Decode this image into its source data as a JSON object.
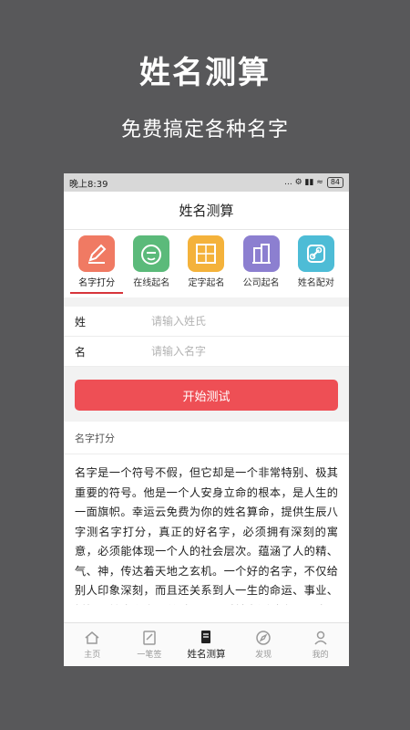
{
  "promo": {
    "title": "姓名测算",
    "subtitle": "免费搞定各种名字"
  },
  "statusbar": {
    "time": "晚上8:39",
    "icons_text": "... ⚙ ▮▮ ≈",
    "battery": "84"
  },
  "navbar": {
    "title": "姓名测算"
  },
  "categories": [
    {
      "label": "名字打分",
      "icon": "pencil-icon",
      "color": "#f07a63",
      "active": true
    },
    {
      "label": "在线起名",
      "icon": "face-name-icon",
      "color": "#5bba7a",
      "active": false
    },
    {
      "label": "定字起名",
      "icon": "grid-name-icon",
      "color": "#f4b23b",
      "active": false
    },
    {
      "label": "公司起名",
      "icon": "building-icon",
      "color": "#8c7fd0",
      "active": false
    },
    {
      "label": "姓名配对",
      "icon": "link-icon",
      "color": "#4dbcd6",
      "active": false
    }
  ],
  "form": {
    "surname_label": "姓",
    "surname_placeholder": "请输入姓氏",
    "given_label": "名",
    "given_placeholder": "请输入名字"
  },
  "start_button": "开始测试",
  "section_title": "名字打分",
  "description": "名字是一个符号不假，但它却是一个非常特别、极其重要的符号。他是一个人安身立命的根本，是人生的一面旗帜。幸运云免费为你的姓名算命，提供生辰八字测名字打分，真正的好名字，必须拥有深刻的寓意，必须能体现一个人的社会层次。蕴涵了人的精、气、神，传达着天地之玄机。一个好的名字，不仅给别人印象深刻，而且还关系到人一生的命运、事业、婚姻、健康和人际关系。可通过姓名测试命运。也可通过姓名测试爱情，查看人一生的命运，三才五格",
  "tabs": [
    {
      "label": "主页",
      "icon": "home-icon",
      "active": false
    },
    {
      "label": "一笔签",
      "icon": "signature-icon",
      "active": false
    },
    {
      "label": "姓名测算",
      "icon": "book-icon",
      "active": true
    },
    {
      "label": "发现",
      "icon": "compass-icon",
      "active": false
    },
    {
      "label": "我的",
      "icon": "user-icon",
      "active": false
    }
  ],
  "colors": {
    "accent": "#ee4f55",
    "underline": "#d7353b",
    "background": "#58585a"
  }
}
